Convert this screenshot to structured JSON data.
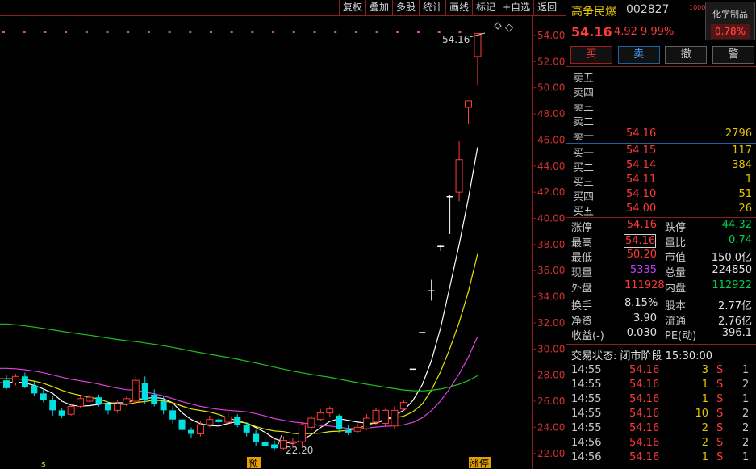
{
  "toolbar": {
    "items": [
      "复权",
      "叠加",
      "多股",
      "统计",
      "画线",
      "标记",
      "+自选",
      "返回"
    ]
  },
  "chart": {
    "price_ticks": [
      "54.00",
      "52.00",
      "50.00",
      "48.00",
      "46.00",
      "44.00",
      "42.00",
      "40.00",
      "38.00",
      "36.00",
      "34.00",
      "32.00",
      "30.00",
      "28.00",
      "26.00",
      "24.00",
      "22.00"
    ],
    "high_label": "54.16",
    "low_label": "22.20",
    "markers": {
      "s": "s",
      "yu": "预",
      "zhangting": "涨停"
    },
    "candles": [
      {
        "o": 27.6,
        "c": 27.0,
        "h": 28.0,
        "l": 26.9
      },
      {
        "o": 27.4,
        "c": 27.9,
        "h": 28.1,
        "l": 27.2
      },
      {
        "o": 27.9,
        "c": 27.1,
        "h": 28.2,
        "l": 27.0
      },
      {
        "o": 27.2,
        "c": 26.6,
        "h": 27.5,
        "l": 26.4
      },
      {
        "o": 26.6,
        "c": 26.1,
        "h": 27.0,
        "l": 25.9
      },
      {
        "o": 26.1,
        "c": 25.3,
        "h": 26.4,
        "l": 24.9
      },
      {
        "o": 25.3,
        "c": 24.9,
        "h": 25.5,
        "l": 24.7
      },
      {
        "o": 25.0,
        "c": 25.6,
        "h": 25.8,
        "l": 24.9
      },
      {
        "o": 25.6,
        "c": 26.2,
        "h": 26.4,
        "l": 25.5
      },
      {
        "o": 26.0,
        "c": 26.3,
        "h": 26.5,
        "l": 25.9
      },
      {
        "o": 26.3,
        "c": 25.8,
        "h": 26.5,
        "l": 25.6
      },
      {
        "o": 25.8,
        "c": 25.3,
        "h": 26.0,
        "l": 25.0
      },
      {
        "o": 25.3,
        "c": 25.8,
        "h": 26.1,
        "l": 25.1
      },
      {
        "o": 25.8,
        "c": 26.2,
        "h": 26.4,
        "l": 25.6
      },
      {
        "o": 26.0,
        "c": 27.6,
        "h": 28.0,
        "l": 25.8
      },
      {
        "o": 27.4,
        "c": 26.1,
        "h": 27.9,
        "l": 25.8
      },
      {
        "o": 26.5,
        "c": 25.8,
        "h": 26.9,
        "l": 25.6
      },
      {
        "o": 26.0,
        "c": 25.3,
        "h": 26.4,
        "l": 25.0
      },
      {
        "o": 25.3,
        "c": 24.6,
        "h": 25.6,
        "l": 24.3
      },
      {
        "o": 24.6,
        "c": 23.8,
        "h": 24.8,
        "l": 23.5
      },
      {
        "o": 23.8,
        "c": 23.5,
        "h": 24.0,
        "l": 23.2
      },
      {
        "o": 23.5,
        "c": 24.2,
        "h": 24.5,
        "l": 23.3
      },
      {
        "o": 24.2,
        "c": 24.6,
        "h": 24.9,
        "l": 24.0
      },
      {
        "o": 24.6,
        "c": 24.4,
        "h": 25.0,
        "l": 24.1
      },
      {
        "o": 24.4,
        "c": 24.8,
        "h": 25.1,
        "l": 24.2
      },
      {
        "o": 24.8,
        "c": 24.2,
        "h": 25.0,
        "l": 24.0
      },
      {
        "o": 24.2,
        "c": 23.6,
        "h": 24.4,
        "l": 23.3
      },
      {
        "o": 23.5,
        "c": 22.9,
        "h": 23.8,
        "l": 22.6
      },
      {
        "o": 22.9,
        "c": 22.6,
        "h": 23.1,
        "l": 22.3
      },
      {
        "o": 22.7,
        "c": 22.4,
        "h": 23.0,
        "l": 22.2
      },
      {
        "o": 22.4,
        "c": 23.0,
        "h": 23.3,
        "l": 22.3
      },
      {
        "o": 22.8,
        "c": 22.9,
        "h": 23.2,
        "l": 22.5
      },
      {
        "o": 22.9,
        "c": 24.2,
        "h": 24.4,
        "l": 22.6
      },
      {
        "o": 24.0,
        "c": 24.7,
        "h": 24.9,
        "l": 23.8
      },
      {
        "o": 24.6,
        "c": 25.1,
        "h": 25.4,
        "l": 24.5
      },
      {
        "o": 25.1,
        "c": 25.4,
        "h": 25.6,
        "l": 24.8
      },
      {
        "o": 24.9,
        "c": 23.9,
        "h": 25.0,
        "l": 23.6
      },
      {
        "o": 23.8,
        "c": 23.6,
        "h": 24.2,
        "l": 23.4
      },
      {
        "o": 23.7,
        "c": 24.0,
        "h": 24.3,
        "l": 23.6
      },
      {
        "o": 23.9,
        "c": 24.7,
        "h": 25.0,
        "l": 23.8
      },
      {
        "o": 24.4,
        "c": 25.3,
        "h": 25.5,
        "l": 24.2
      },
      {
        "o": 24.3,
        "c": 25.3,
        "h": 25.4,
        "l": 24.1
      },
      {
        "o": 24.1,
        "c": 25.3,
        "h": 25.6,
        "l": 23.9
      },
      {
        "o": 25.4,
        "c": 25.9,
        "h": 26.1,
        "l": 25.3
      },
      {
        "o": 28.5,
        "c": 28.5,
        "h": 28.5,
        "l": 28.5
      },
      {
        "o": 31.3,
        "c": 31.3,
        "h": 31.3,
        "l": 31.3
      },
      {
        "o": 34.5,
        "c": 34.5,
        "h": 35.3,
        "l": 33.7
      },
      {
        "o": 37.9,
        "c": 37.9,
        "h": 38.0,
        "l": 37.5
      },
      {
        "o": 41.7,
        "c": 41.7,
        "h": 41.8,
        "l": 38.8
      },
      {
        "o": 42.0,
        "c": 44.5,
        "h": 45.9,
        "l": 41.3
      },
      {
        "o": 48.5,
        "c": 49.0,
        "h": 49.0,
        "l": 47.2
      },
      {
        "o": 52.4,
        "c": 54.16,
        "h": 54.16,
        "l": 50.2
      }
    ]
  },
  "header": {
    "stock_name": "高争民爆",
    "stock_code": "002827",
    "badge": "1000",
    "sector_name": "化学制品",
    "sector_pct": "0.78%",
    "price": "54.16",
    "change": "4.92",
    "change_pct": "9.99%"
  },
  "trade_buttons": {
    "buy": "买",
    "sell": "卖",
    "cancel": "撤",
    "alert": "警"
  },
  "order_book": {
    "asks": [
      {
        "label": "卖五",
        "price": "",
        "vol": ""
      },
      {
        "label": "卖四",
        "price": "",
        "vol": ""
      },
      {
        "label": "卖三",
        "price": "",
        "vol": ""
      },
      {
        "label": "卖二",
        "price": "",
        "vol": ""
      },
      {
        "label": "卖一",
        "price": "54.16",
        "vol": "2796"
      }
    ],
    "bids": [
      {
        "label": "买一",
        "price": "54.15",
        "vol": "117"
      },
      {
        "label": "买二",
        "price": "54.14",
        "vol": "384"
      },
      {
        "label": "买三",
        "price": "54.11",
        "vol": "1"
      },
      {
        "label": "买四",
        "price": "54.10",
        "vol": "51"
      },
      {
        "label": "买五",
        "price": "54.00",
        "vol": "26"
      }
    ]
  },
  "quote": {
    "rows1": [
      {
        "l1": "涨停",
        "v1": "54.16",
        "c1": "red",
        "l2": "跌停",
        "v2": "44.32",
        "c2": "green"
      },
      {
        "l1": "最高",
        "v1": "54.16",
        "c1": "red",
        "l2": "量比",
        "v2": "0.74",
        "c2": "green"
      },
      {
        "l1": "最低",
        "v1": "50.20",
        "c1": "red",
        "l2": "市值",
        "v2": "150.0亿",
        "c2": "white"
      },
      {
        "l1": "现量",
        "v1": "5335",
        "c1": "purple",
        "l2": "总量",
        "v2": "224850",
        "c2": "white"
      },
      {
        "l1": "外盘",
        "v1": "111928",
        "c1": "red",
        "l2": "内盘",
        "v2": "112922",
        "c2": "green"
      }
    ],
    "rows2": [
      {
        "l1": "换手",
        "v1": "8.15%",
        "c1": "white",
        "l2": "股本",
        "v2": "2.77亿",
        "c2": "white"
      },
      {
        "l1": "净资",
        "v1": "3.90",
        "c1": "white",
        "l2": "流通",
        "v2": "2.76亿",
        "c2": "white"
      },
      {
        "l1": "收益(-)",
        "v1": "0.030",
        "c1": "white",
        "l2": "PE(动)",
        "v2": "396.1",
        "c2": "white"
      }
    ]
  },
  "status": {
    "text": "交易状态: 闭市阶段 15:30:00"
  },
  "ticks": [
    {
      "time": "14:55",
      "price": "54.16",
      "vol": "3",
      "side": "S",
      "n": "1"
    },
    {
      "time": "14:55",
      "price": "54.16",
      "vol": "1",
      "side": "S",
      "n": "2"
    },
    {
      "time": "14:55",
      "price": "54.16",
      "vol": "1",
      "side": "S",
      "n": "1"
    },
    {
      "time": "14:55",
      "price": "54.16",
      "vol": "10",
      "side": "S",
      "n": "2"
    },
    {
      "time": "14:55",
      "price": "54.16",
      "vol": "2",
      "side": "S",
      "n": "2"
    },
    {
      "time": "14:56",
      "price": "54.16",
      "vol": "2",
      "side": "S",
      "n": "2"
    },
    {
      "time": "14:56",
      "price": "54.16",
      "vol": "1",
      "side": "S",
      "n": "1"
    }
  ],
  "colors": {
    "up": "#ff3a3a",
    "down": "#00e0e0",
    "ma5": "#ffffff",
    "ma10": "#e6e600",
    "ma20": "#e040e0",
    "ma60": "#20c020"
  }
}
